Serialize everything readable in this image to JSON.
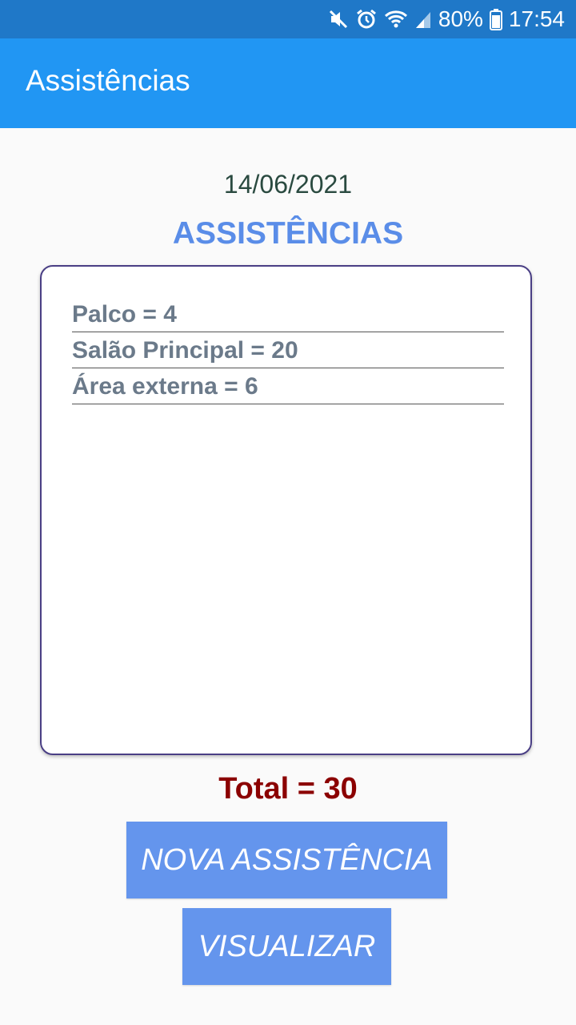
{
  "status_bar": {
    "battery": "80%",
    "time": "17:54",
    "icons": [
      "mute-icon",
      "alarm-icon",
      "wifi-icon",
      "signal-icon",
      "battery-icon"
    ]
  },
  "app_bar": {
    "title": "Assistências"
  },
  "main": {
    "date": "14/06/2021",
    "heading": "ASSISTÊNCIAS",
    "items": [
      {
        "label": "Palco = 4"
      },
      {
        "label": "Salão Principal = 20"
      },
      {
        "label": "Área externa = 6"
      }
    ],
    "total": "Total = 30"
  },
  "buttons": {
    "new_label": "NOVA ASSISTÊNCIA",
    "view_label": "VISUALIZAR"
  },
  "colors": {
    "status_bar": "#1f78c8",
    "app_bar": "#2196f3",
    "heading": "#5a8de8",
    "total": "#8b0000",
    "button": "#6495ed"
  }
}
